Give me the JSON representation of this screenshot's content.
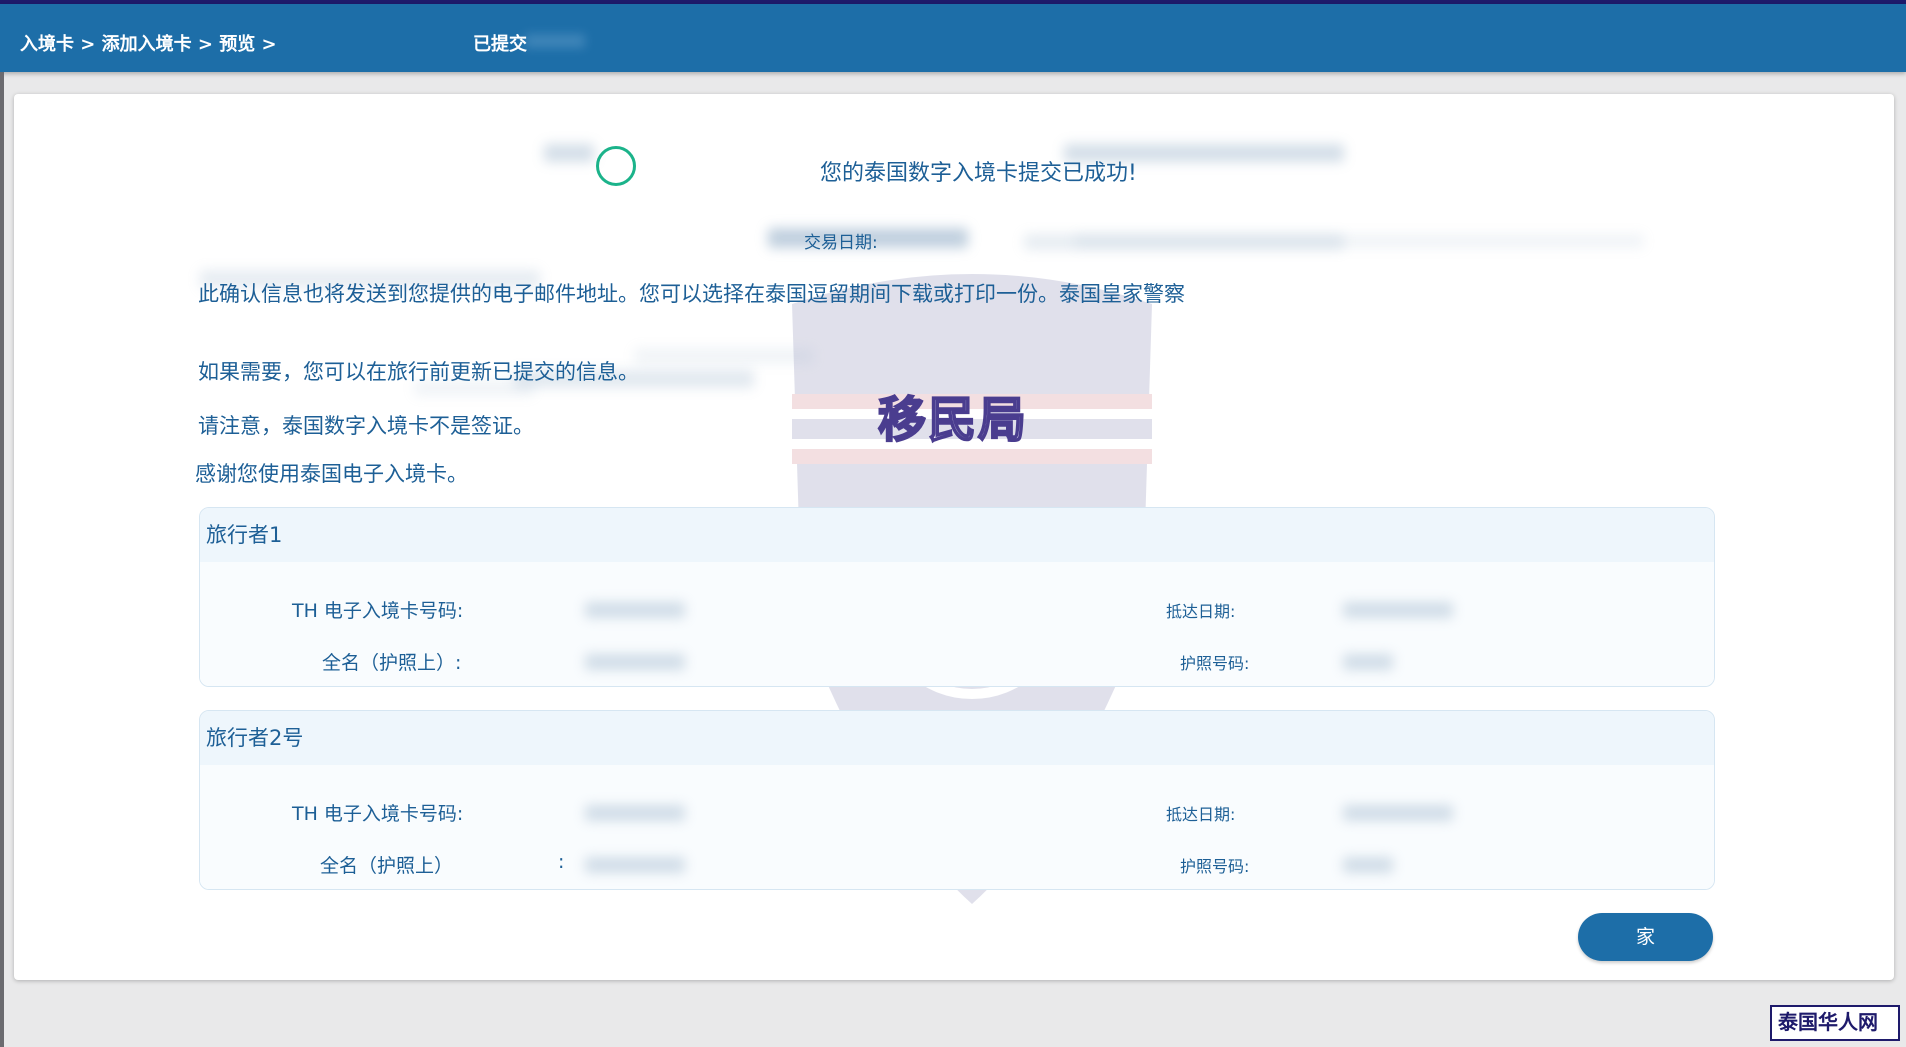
{
  "header": {
    "breadcrumb": "入境卡 > 添加入境卡 > 预览 >",
    "current": "已提交"
  },
  "confirmation": {
    "title": "您的泰国数字入境卡提交已成功!",
    "date_label": "交易日期:",
    "line1": "此确认信息也将发送到您提供的电子邮件地址。您可以选择在泰国逗留期间下载或打印一份。泰国皇家警察",
    "line2": "如果需要，您可以在旅行前更新已提交的信息。",
    "line3": "请注意，泰国数字入境卡不是签证。",
    "line4": "感谢您使用泰国电子入境卡。"
  },
  "watermark": {
    "text": "移民局"
  },
  "travelers": [
    {
      "title": "旅行者1",
      "card_label": "TH 电子入境卡号码:",
      "name_label": "全名（护照上）:",
      "arrival_label": "抵达日期:",
      "passport_label": "护照号码:"
    },
    {
      "title": "旅行者2号",
      "card_label": "TH 电子入境卡号码:",
      "name_label": "全名（护照上）",
      "name_colon": ":",
      "arrival_label": "抵达日期:",
      "passport_label": "护照号码:"
    }
  ],
  "buttons": {
    "home": "家"
  },
  "brand": {
    "logo": "泰国华人网"
  },
  "colors": {
    "primary": "#1d6ea8",
    "text": "#1d5f96",
    "success": "#1bb38a"
  }
}
